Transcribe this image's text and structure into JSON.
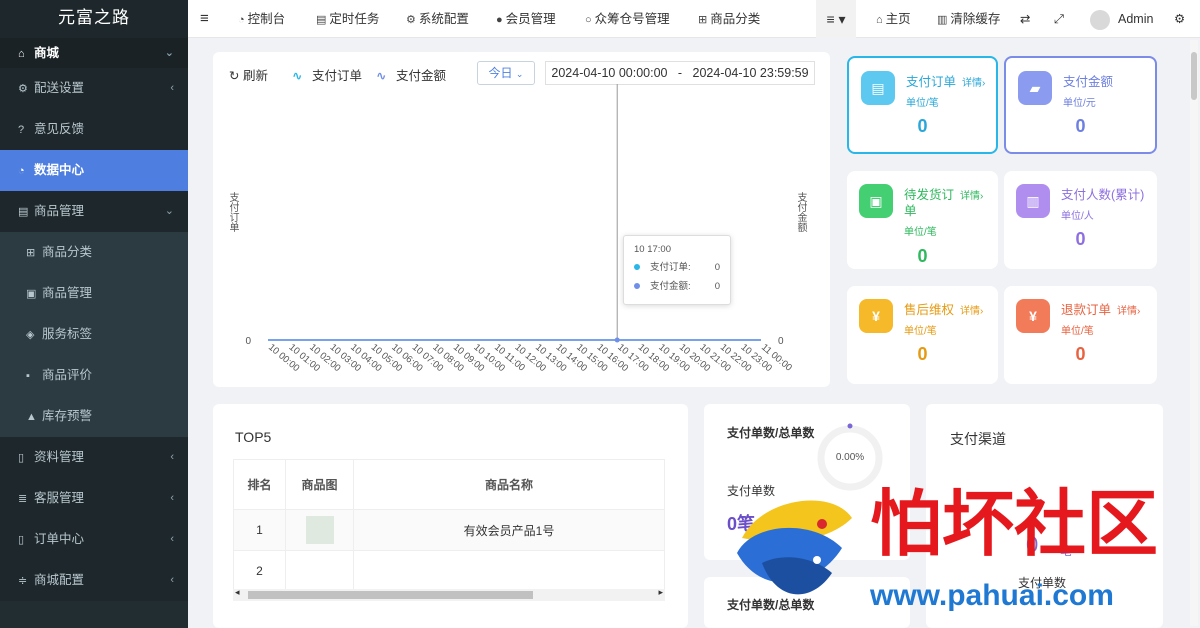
{
  "app": {
    "brand": "元富之路"
  },
  "sidebar": {
    "top": {
      "label": "商城"
    },
    "items": [
      {
        "label": "配送设置"
      },
      {
        "label": "意见反馈"
      },
      {
        "label": "数据中心"
      },
      {
        "label": "商品管理"
      },
      {
        "label": "商品分类"
      },
      {
        "label": "商品管理"
      },
      {
        "label": "服务标签"
      },
      {
        "label": "商品评价"
      },
      {
        "label": "库存预警"
      },
      {
        "label": "资料管理"
      },
      {
        "label": "客服管理"
      },
      {
        "label": "订单中心"
      },
      {
        "label": "商城配置"
      }
    ]
  },
  "topnav": {
    "items": [
      {
        "label": "控制台"
      },
      {
        "label": "定时任务"
      },
      {
        "label": "系统配置"
      },
      {
        "label": "会员管理"
      },
      {
        "label": "众筹仓号管理"
      },
      {
        "label": "商品分类"
      }
    ],
    "home": "主页",
    "clear_cache": "清除缓存",
    "user": "Admin"
  },
  "chart": {
    "refresh": "刷新",
    "legend_orders": "支付订单",
    "legend_amount": "支付金额",
    "range_select": "今日",
    "date_start": "2024-04-10 00:00:00",
    "date_sep": "-",
    "date_end": "2024-04-10 23:59:59",
    "ylabel_left": "支付订单",
    "ylabel_right": "支付金额",
    "tooltip": {
      "title": "10 17:00",
      "orders_label": "支付订单:",
      "orders_value": "0",
      "amount_label": "支付金额:",
      "amount_value": "0"
    }
  },
  "chart_data": {
    "type": "line",
    "x": [
      "10 00:00",
      "10 01:00",
      "10 02:00",
      "10 03:00",
      "10 04:00",
      "10 05:00",
      "10 06:00",
      "10 07:00",
      "10 08:00",
      "10 09:00",
      "10 10:00",
      "10 11:00",
      "10 12:00",
      "10 13:00",
      "10 14:00",
      "10 15:00",
      "10 16:00",
      "10 17:00",
      "10 18:00",
      "10 19:00",
      "10 20:00",
      "10 21:00",
      "10 22:00",
      "10 23:00",
      "11 00:00"
    ],
    "series": [
      {
        "name": "支付订单",
        "values": [
          0,
          0,
          0,
          0,
          0,
          0,
          0,
          0,
          0,
          0,
          0,
          0,
          0,
          0,
          0,
          0,
          0,
          0,
          0,
          0,
          0,
          0,
          0,
          0,
          0
        ],
        "color": "#29b6e8"
      },
      {
        "name": "支付金额",
        "values": [
          0,
          0,
          0,
          0,
          0,
          0,
          0,
          0,
          0,
          0,
          0,
          0,
          0,
          0,
          0,
          0,
          0,
          0,
          0,
          0,
          0,
          0,
          0,
          0,
          0
        ],
        "color": "#6f8fe8"
      }
    ],
    "ylabel_left": "支付订单",
    "ylabel_right": "支付金额",
    "ytick": "0",
    "yright_tick": "0",
    "grid": false,
    "legend": "top-left"
  },
  "stats": [
    {
      "title": "支付订单",
      "unit": "单位/笔",
      "detail": "详情›",
      "value": "0",
      "color": "#29b6e8"
    },
    {
      "title": "支付金额",
      "unit": "单位/元",
      "detail": "",
      "value": "0",
      "color": "#7b8be8"
    },
    {
      "title": "待发货订单",
      "unit": "单位/笔",
      "detail": "详情›",
      "value": "0",
      "color": "#3cc66b"
    },
    {
      "title": "支付人数(累计)",
      "unit": "单位/人",
      "detail": "",
      "value": "0",
      "color": "#9a7be6"
    },
    {
      "title": "售后维权",
      "unit": "单位/笔",
      "detail": "详情›",
      "value": "0",
      "color": "#f2a31c"
    },
    {
      "title": "退款订单",
      "unit": "单位/笔",
      "detail": "详情›",
      "value": "0",
      "color": "#f0704c"
    }
  ],
  "top5": {
    "title": "TOP5",
    "columns": [
      "排名",
      "商品图",
      "商品名称"
    ],
    "rows": [
      {
        "rank": "1",
        "name": "有效会员产品1号"
      },
      {
        "rank": "2",
        "name": ""
      }
    ]
  },
  "ratio": {
    "title": "支付单数/总单数",
    "percent": "0.00%",
    "paid_label": "支付单数",
    "paid_value": "0笔",
    "second_title": "支付单数/总单数"
  },
  "channels": {
    "title": "支付渠道",
    "count": "0",
    "count_unit": "笔",
    "sublabel": "支付单数"
  },
  "watermark": {
    "text": "怕坏社区",
    "url": "www.pahuai.com"
  }
}
